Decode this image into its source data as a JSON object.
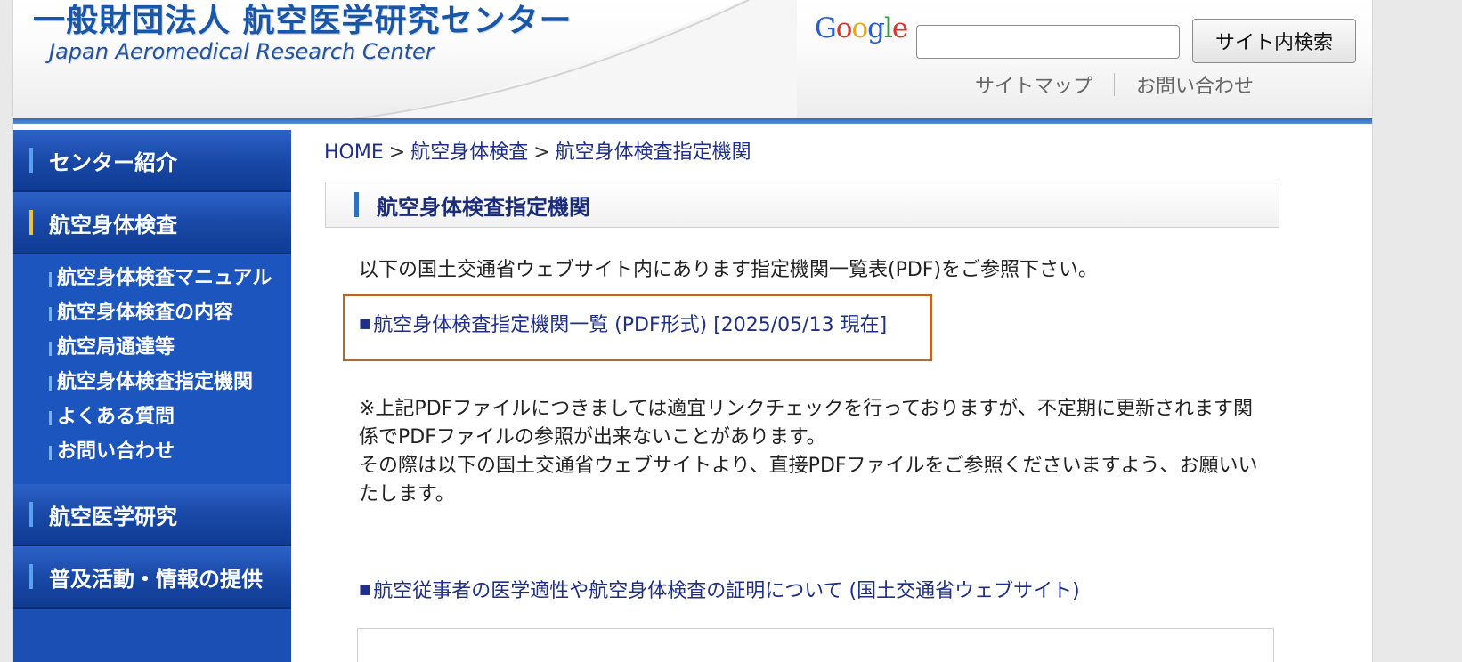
{
  "header": {
    "logo_ja": "一般財団法人 航空医学研究センター",
    "logo_en": "Japan Aeromedical Research Center",
    "search": {
      "google_letters": [
        "G",
        "o",
        "o",
        "g",
        "l",
        "e"
      ],
      "google_colors": [
        "#2a5bd7",
        "#d6362c",
        "#e8a81a",
        "#2a5bd7",
        "#2c9a46",
        "#d6362c"
      ],
      "input_value": "",
      "button_label": "サイト内検索"
    },
    "util_links": [
      "サイトマップ",
      "お問い合わせ"
    ]
  },
  "sidebar": {
    "main_items": [
      {
        "label": "センター紹介"
      },
      {
        "label": "航空身体検査",
        "active": true
      },
      {
        "label": "航空医学研究"
      },
      {
        "label": "普及活動・情報の提供"
      }
    ],
    "sub_items": [
      "航空身体検査マニュアル",
      "航空身体検査の内容",
      "航空局通達等",
      "航空身体検査指定機関",
      "よくある質問",
      "お問い合わせ"
    ]
  },
  "main": {
    "breadcrumb": {
      "home": "HOME",
      "sep": ">",
      "level1": "航空身体検査",
      "current": "航空身体検査指定機関"
    },
    "section_title": "航空身体検査指定機関",
    "intro": "以下の国土交通省ウェブサイト内にあります指定機関一覧表(PDF)をご参照下さい。",
    "pdf_link": {
      "bullet": "■",
      "label": "航空身体検査指定機関一覧 (PDF形式) [2025/05/13 現在]"
    },
    "notice": [
      "※上記PDFファイルにつきましては適宜リンクチェックを行っておりますが、不定期に更新されます関係でPDFファイルの参照が出来ないことがあります。",
      "その際は以下の国土交通省ウェブサイトより、直接PDFファイルをご参照くださいますよう、お願いいたします。"
    ],
    "mlit_link": {
      "bullet": "■",
      "label": "航空従事者の医学適性や航空身体検査の証明について (国土交通省ウェブサイト)"
    }
  },
  "colors": {
    "sidebar_bg": "#1b4fb4",
    "link": "#1f2f86",
    "highlight_border": "#b46a2e",
    "active_marker": "#f0c23a"
  }
}
